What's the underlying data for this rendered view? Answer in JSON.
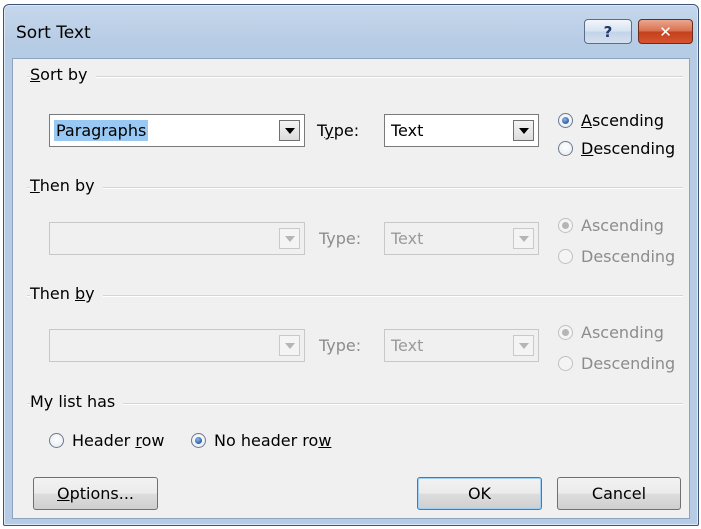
{
  "window": {
    "title": "Sort Text",
    "help_label": "?",
    "close_label": "✕"
  },
  "sort_by": {
    "label_accel": "S",
    "label_rest": "ort by",
    "field_value": "Paragraphs",
    "type_label_pre": "T",
    "type_label_accel": "y",
    "type_label_post": "pe:",
    "type_value": "Text",
    "ascending_accel": "A",
    "ascending_rest": "scending",
    "descending_accel": "D",
    "descending_rest": "escending",
    "order": "ascending"
  },
  "then_by_1": {
    "label_accel": "T",
    "label_rest": "hen by",
    "field_value": "",
    "type_label": "Type:",
    "type_value": "Text",
    "ascending": "Ascending",
    "descending": "Descending",
    "order": "ascending",
    "enabled": false
  },
  "then_by_2": {
    "label_pre": "Then ",
    "label_accel": "b",
    "label_rest": "y",
    "field_value": "",
    "type_label": "Type:",
    "type_value": "Text",
    "ascending": "Ascending",
    "descending": "Descending",
    "order": "ascending",
    "enabled": false
  },
  "list_has": {
    "label": "My list has",
    "header_row_pre": "Header ",
    "header_row_accel": "r",
    "header_row_post": "ow",
    "no_header_row_pre": "No header ro",
    "no_header_row_accel": "w",
    "selected": "no_header_row"
  },
  "buttons": {
    "options_accel": "O",
    "options_rest": "ptions...",
    "ok": "OK",
    "cancel": "Cancel"
  }
}
